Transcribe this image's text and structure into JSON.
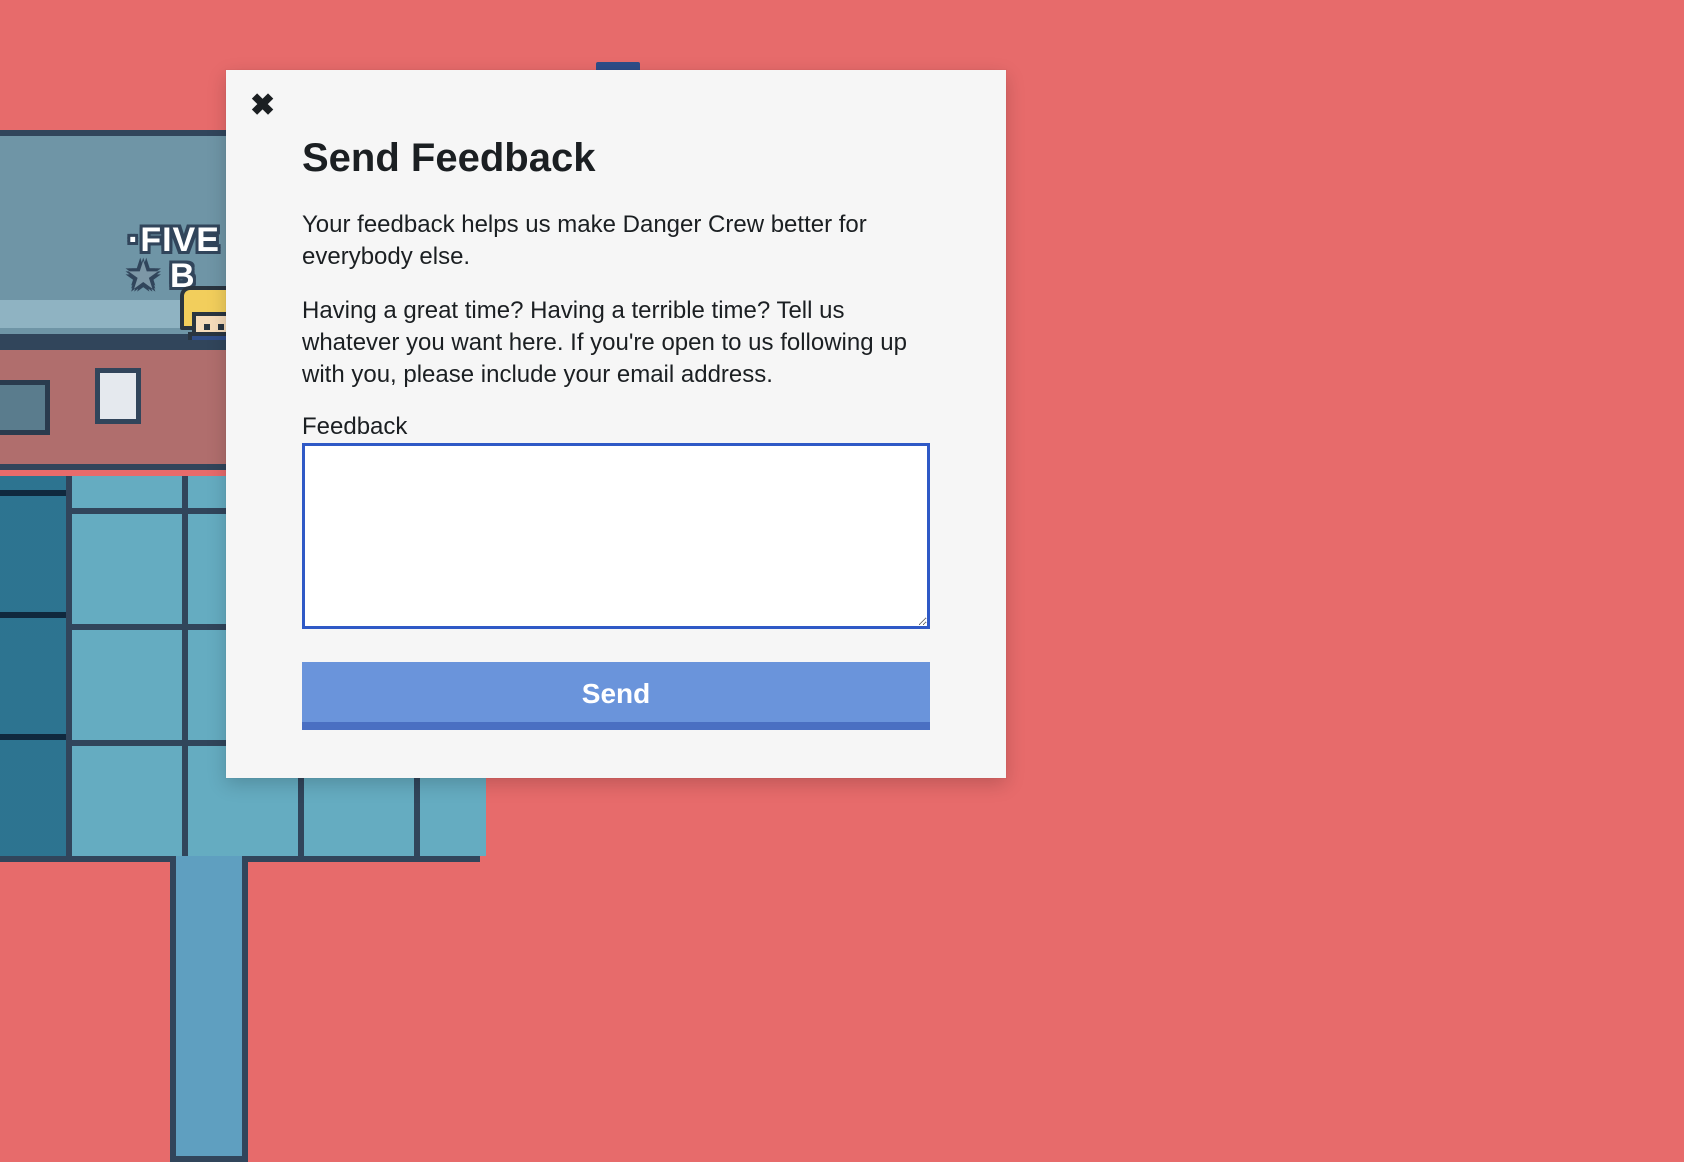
{
  "background": {
    "sign_line1": "·FIVE",
    "sign_line2_prefix": "★ ",
    "sign_line2": "B"
  },
  "modal": {
    "title": "Send Feedback",
    "intro_p1": "Your feedback helps us make Danger Crew better for everybody else.",
    "intro_p2": "Having a great time? Having a terrible time? Tell us whatever you want here. If you're open to us following up with you, please include your email address.",
    "field_label": "Feedback",
    "textarea_value": "",
    "send_label": "Send",
    "close_glyph": "✖"
  },
  "colors": {
    "page_bg": "#e76b6b",
    "modal_bg": "#f6f6f6",
    "accent_blue": "#2f59c6",
    "button_blue": "#6a94db",
    "button_blue_dark": "#4a6fc2"
  }
}
